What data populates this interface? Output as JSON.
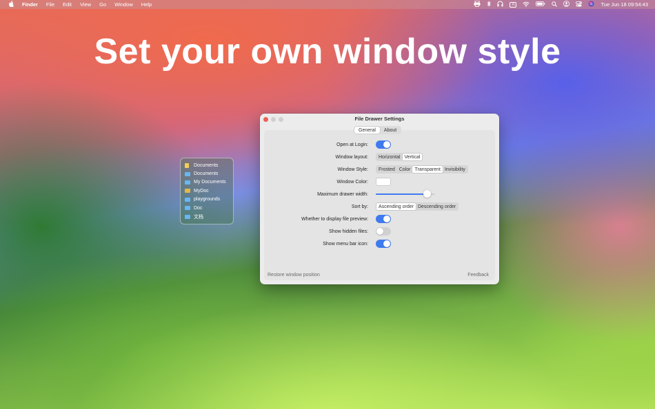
{
  "menubar": {
    "apple_icon": "apple-logo-icon",
    "app_name": "Finder",
    "menus": [
      "File",
      "Edit",
      "View",
      "Go",
      "Window",
      "Help"
    ],
    "status_icons": [
      "printer-icon",
      "bluetooth-icon",
      "headphones-icon",
      "input-source-icon",
      "wifi-icon",
      "battery-icon",
      "search-icon",
      "user-icon",
      "control-center-icon",
      "siri-icon"
    ],
    "input_source_label": "A",
    "datetime": "Tue Jun 18  09:54:43"
  },
  "headline": "Set your own window style",
  "drawer": {
    "items": [
      {
        "label": "Documents",
        "icon": "document-icon"
      },
      {
        "label": "Documents",
        "icon": "folder-icon"
      },
      {
        "label": "My Documents",
        "icon": "folder-icon"
      },
      {
        "label": "MyDoc",
        "icon": "image-icon"
      },
      {
        "label": "playgrounds",
        "icon": "folder-icon"
      },
      {
        "label": "Doc",
        "icon": "folder-icon"
      },
      {
        "label": "文档",
        "icon": "folder-icon"
      }
    ]
  },
  "window": {
    "title": "File Drawer Settings",
    "tabs": [
      "General",
      "About"
    ],
    "selected_tab": "General",
    "settings": {
      "open_at_login": {
        "label": "Open at Login:",
        "value": true
      },
      "window_layout": {
        "label": "Window layout:",
        "options": [
          "Horizontal",
          "Vertical"
        ],
        "selected": "Vertical"
      },
      "window_style": {
        "label": "Window Style:",
        "options": [
          "Frosted",
          "Color",
          "Transparent",
          "Invisibility"
        ],
        "selected": "Transparent"
      },
      "window_color": {
        "label": "Window Color:",
        "value": "#ffffff"
      },
      "max_drawer_width": {
        "label": "Maximum drawer width:",
        "value": 0.92
      },
      "sort_by": {
        "label": "Sort by:",
        "options": [
          "Ascending order",
          "Descending order"
        ],
        "selected": "Ascending order"
      },
      "file_preview": {
        "label": "Whether to display file preview:",
        "value": true
      },
      "show_hidden": {
        "label": "Show hidden files:",
        "value": false
      },
      "menu_bar_icon": {
        "label": "Show menu bar icon:",
        "value": true
      }
    },
    "footer": {
      "restore": "Restore window position",
      "feedback": "Feedback"
    }
  },
  "colors": {
    "accent": "#3f7bef",
    "close_button": "#ee5f57"
  }
}
